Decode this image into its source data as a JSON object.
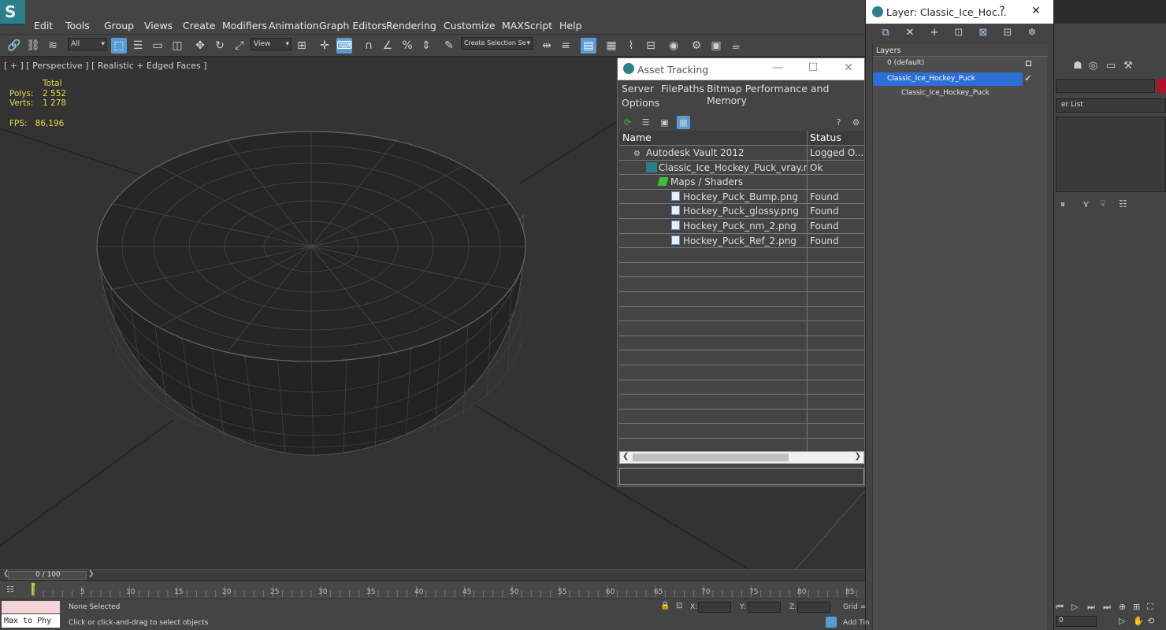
{
  "app": {
    "logo_letter": "S",
    "menu": [
      "Edit",
      "Tools",
      "Group",
      "Views",
      "Create",
      "Modifiers",
      "Animation",
      "Graph Editors",
      "Rendering",
      "Customize",
      "MAXScript",
      "Help"
    ]
  },
  "toolbar": {
    "selection_filter": "All",
    "ref_coord": "View",
    "named_selection": "Create Selection Se"
  },
  "viewport": {
    "label": "[ + ] [ Perspective ] [ Realistic + Edged Faces ]",
    "stats": {
      "total_label": "Total",
      "polys_label": "Polys:",
      "polys_value": "2 552",
      "verts_label": "Verts:",
      "verts_value": "1 278",
      "fps_label": "FPS:",
      "fps_value": "86,196"
    }
  },
  "asset_tracking": {
    "title": "Asset Tracking",
    "menu": [
      "Server",
      "File",
      "Paths",
      "Bitmap Performance and Memory",
      "Options"
    ],
    "columns": [
      "Name",
      "Status"
    ],
    "rows": [
      {
        "name": "Autodesk Vault 2012",
        "status": "Logged O..."
      },
      {
        "name": "Classic_Ice_Hockey_Puck_vray.max",
        "status": "Ok"
      },
      {
        "name": "Maps / Shaders",
        "status": ""
      },
      {
        "name": "Hockey_Puck_Bump.png",
        "status": "Found"
      },
      {
        "name": "Hockey_Puck_glossy.png",
        "status": "Found"
      },
      {
        "name": "Hockey_Puck_nm_2.png",
        "status": "Found"
      },
      {
        "name": "Hockey_Puck_Ref_2.png",
        "status": "Found"
      }
    ]
  },
  "layer_window": {
    "title": "Layer: Classic_Ice_Hoc...",
    "help": "?",
    "header": "Layers",
    "layers": [
      {
        "name": "0 (default)"
      },
      {
        "name": "Classic_Ice_Hockey_Puck"
      },
      {
        "name": "Classic_Ice_Hockey_Puck"
      }
    ]
  },
  "command_panel": {
    "modifier_list": "er List"
  },
  "timeline": {
    "frame": "0 / 100",
    "ticks": [
      "5",
      "10",
      "15",
      "20",
      "25",
      "30",
      "35",
      "40",
      "45",
      "50",
      "55",
      "60",
      "65",
      "70",
      "75",
      "80",
      "85"
    ]
  },
  "status": {
    "maxscript": "Max to Phy",
    "selection": "None Selected",
    "prompt": "Click or click-and-drag to select objects",
    "x_label": "X:",
    "y_label": "Y:",
    "z_label": "Z:",
    "grid": "Grid =",
    "add_time": "Add Tin",
    "frame_field": "0"
  }
}
